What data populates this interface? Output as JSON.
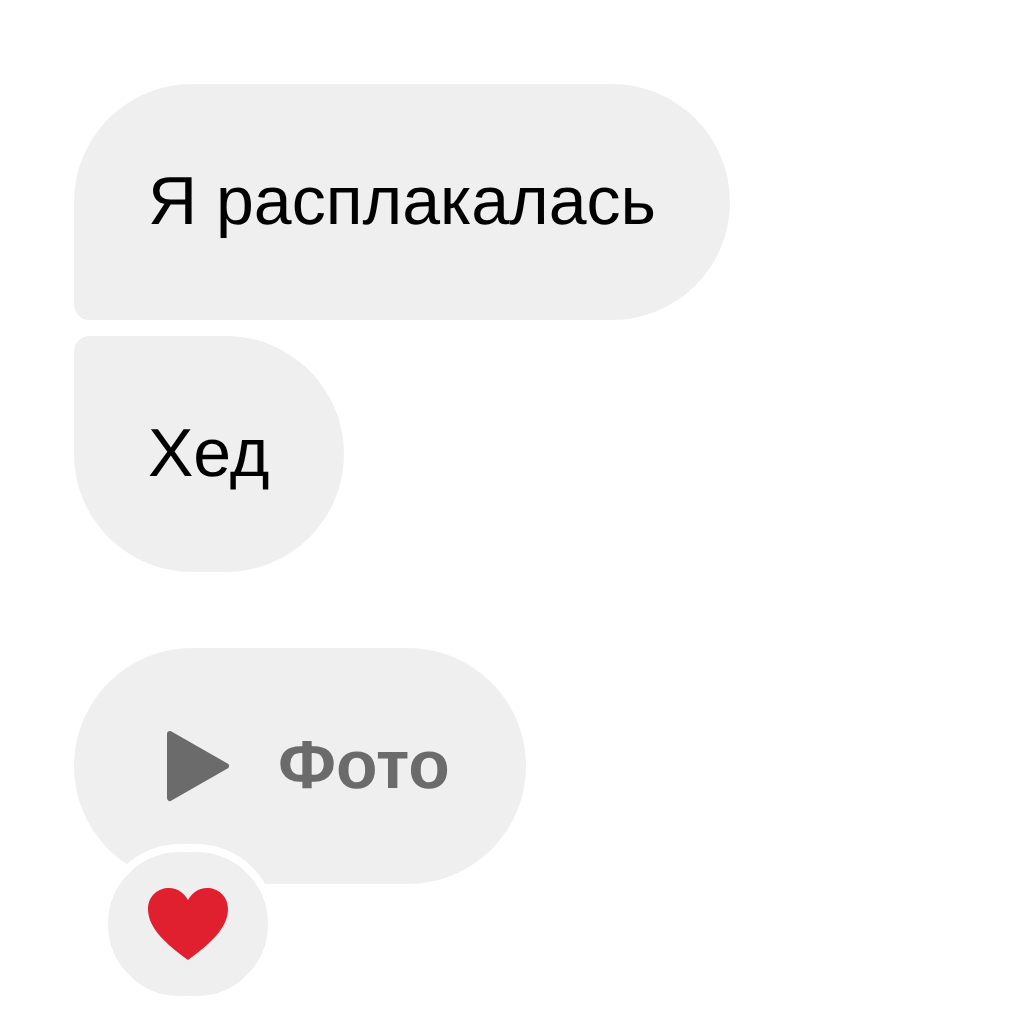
{
  "messages": [
    {
      "kind": "text",
      "text": "Я расплакалась",
      "joined_above": false,
      "joined_below": true
    },
    {
      "kind": "text",
      "text": "Хед",
      "joined_above": true,
      "joined_below": false
    },
    {
      "kind": "media",
      "text": "Фото",
      "joined_above": false,
      "joined_below": false,
      "reaction": {
        "kind": "heart"
      }
    }
  ]
}
